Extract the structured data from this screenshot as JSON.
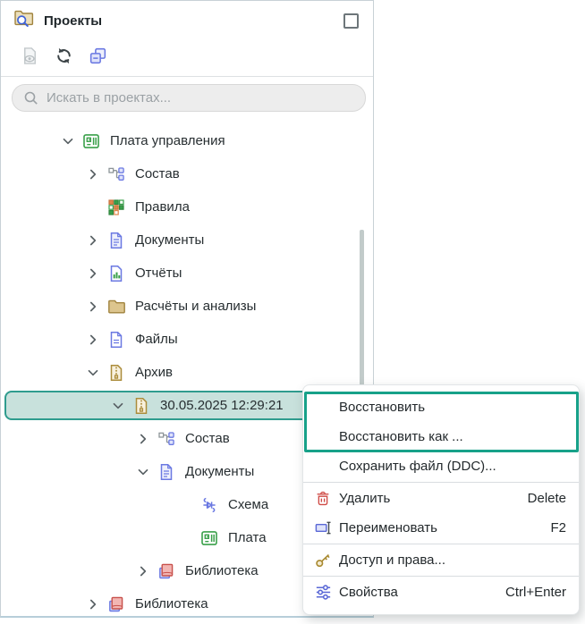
{
  "colors": {
    "accent": "#17a189",
    "selection_fill": "#c8e1dc",
    "selection_border": "#2f9c8e"
  },
  "panel": {
    "title": "Проекты",
    "dock_button": "float-window",
    "toolbar": [
      {
        "name": "preview-document-button",
        "icon": "doc-eye",
        "disabled": true
      },
      {
        "name": "refresh-button",
        "icon": "refresh",
        "disabled": false
      },
      {
        "name": "collapse-all-button",
        "icon": "collapse-all",
        "disabled": false
      }
    ],
    "search": {
      "placeholder": "Искать в проектах...",
      "value": ""
    }
  },
  "tree": {
    "rows": [
      {
        "level": 0,
        "chevron": "down",
        "icon": "board",
        "label": "Плата управления",
        "selected": false
      },
      {
        "level": 1,
        "chevron": "right",
        "icon": "structure",
        "label": "Состав",
        "selected": false
      },
      {
        "level": 1,
        "chevron": "none",
        "icon": "rules",
        "label": "Правила",
        "selected": false
      },
      {
        "level": 1,
        "chevron": "right",
        "icon": "doc",
        "label": "Документы",
        "selected": false
      },
      {
        "level": 1,
        "chevron": "right",
        "icon": "report",
        "label": "Отчёты",
        "selected": false
      },
      {
        "level": 1,
        "chevron": "right",
        "icon": "folder",
        "label": "Расчёты и анализы",
        "selected": false
      },
      {
        "level": 1,
        "chevron": "right",
        "icon": "file",
        "label": "Файлы",
        "selected": false
      },
      {
        "level": 1,
        "chevron": "down",
        "icon": "archive",
        "label": "Архив",
        "selected": false
      },
      {
        "level": 2,
        "chevron": "down",
        "icon": "archive",
        "label": "30.05.2025 12:29:21",
        "selected": true
      },
      {
        "level": 3,
        "chevron": "right",
        "icon": "structure",
        "label": "Состав",
        "selected": false
      },
      {
        "level": 3,
        "chevron": "down",
        "icon": "doc",
        "label": "Документы",
        "selected": false
      },
      {
        "level": 4,
        "chevron": "none",
        "icon": "schematic",
        "label": "Схема",
        "selected": false
      },
      {
        "level": 4,
        "chevron": "none",
        "icon": "board",
        "label": "Плата",
        "selected": false
      },
      {
        "level": 3,
        "chevron": "right",
        "icon": "library",
        "label": "Библиотека",
        "selected": false
      },
      {
        "level": 1,
        "chevron": "right",
        "icon": "library",
        "label": "Библиотека",
        "selected": false
      }
    ]
  },
  "menu": {
    "items": [
      {
        "label": "Восстановить",
        "icon": "",
        "shortcut": "",
        "sep_after": false
      },
      {
        "label": "Восстановить как ...",
        "icon": "",
        "shortcut": "",
        "sep_after": false
      },
      {
        "label": "Сохранить файл (DDC)...",
        "icon": "",
        "shortcut": "",
        "sep_after": true
      },
      {
        "label": "Удалить",
        "icon": "trash",
        "shortcut": "Delete",
        "sep_after": false
      },
      {
        "label": "Переименовать",
        "icon": "rename",
        "shortcut": "F2",
        "sep_after": true
      },
      {
        "label": "Доступ и права...",
        "icon": "key",
        "shortcut": "",
        "sep_after": true
      },
      {
        "label": "Свойства",
        "icon": "sliders",
        "shortcut": "Ctrl+Enter",
        "sep_after": false
      }
    ],
    "highlighted_item_count": 2
  }
}
